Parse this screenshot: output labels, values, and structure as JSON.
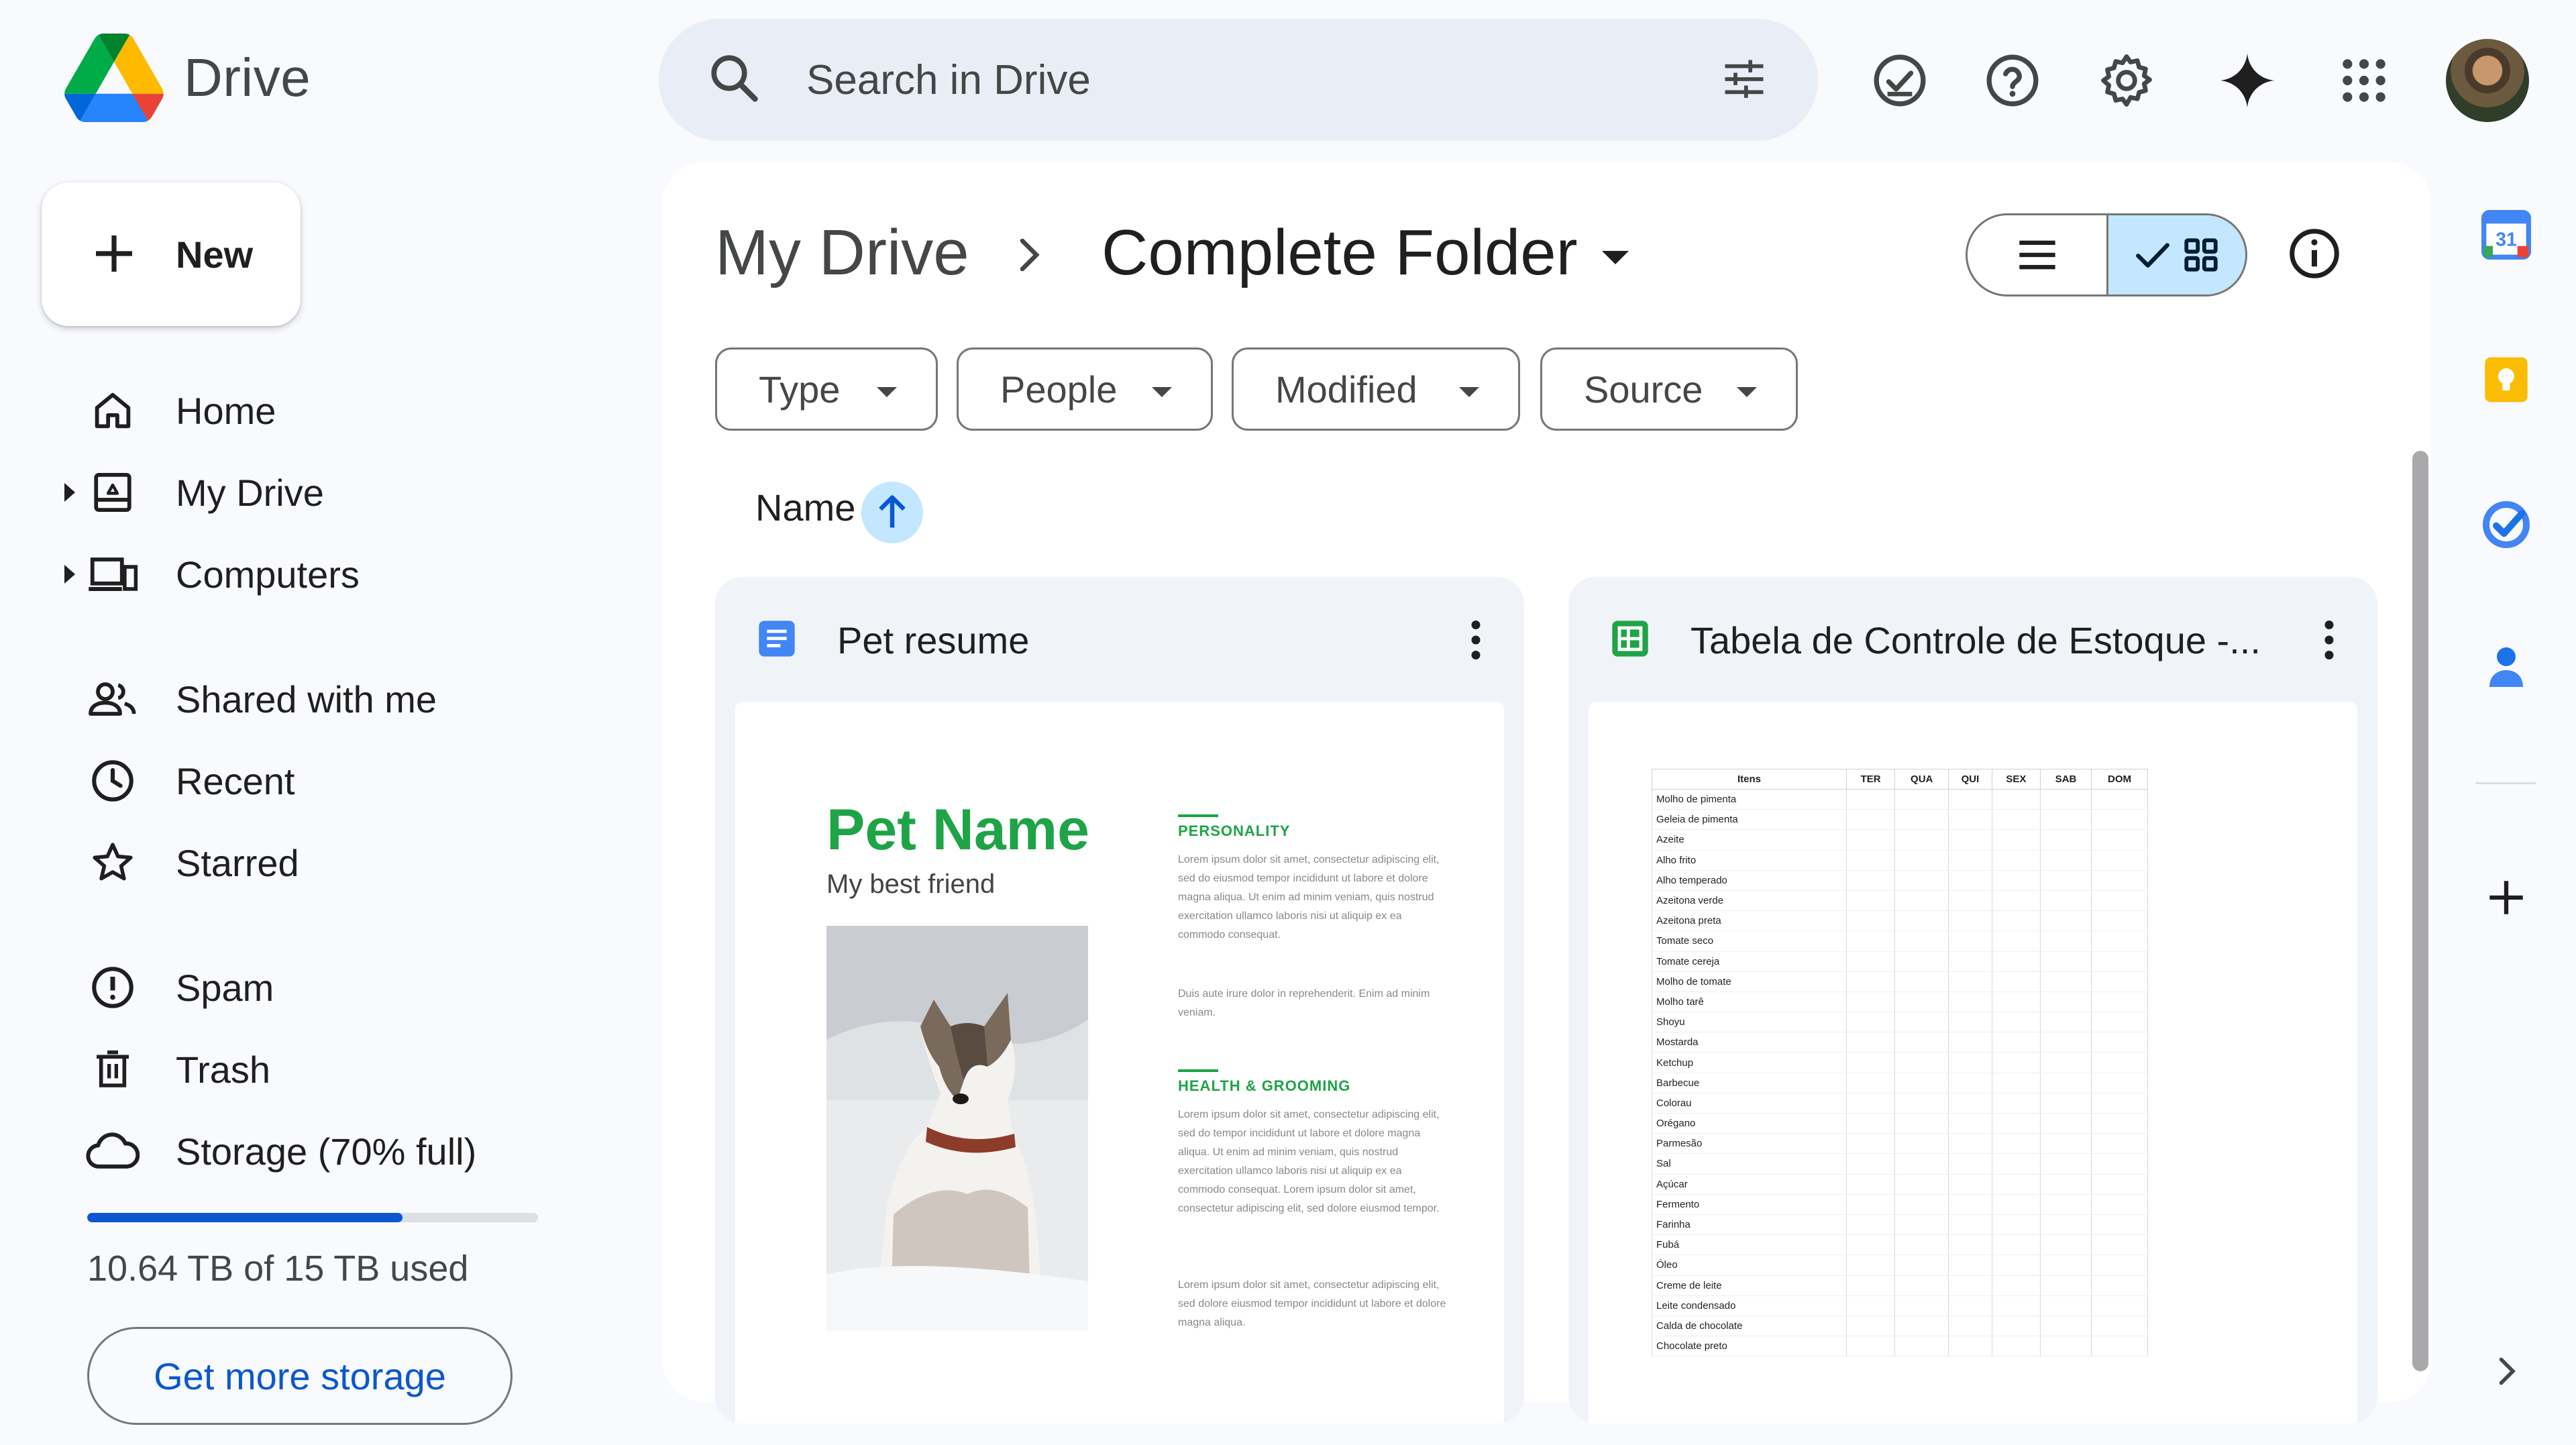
{
  "app": {
    "name": "Drive"
  },
  "search": {
    "placeholder": "Search in Drive"
  },
  "header_icons": [
    "ready-for-offline-icon",
    "help-icon",
    "settings-icon",
    "gemini-sparkle-icon",
    "apps-grid-icon",
    "account-avatar"
  ],
  "sidebar": {
    "new_label": "New",
    "items": [
      {
        "label": "Home",
        "icon": "home-icon"
      },
      {
        "label": "My Drive",
        "icon": "my-drive-icon",
        "expandable": true
      },
      {
        "label": "Computers",
        "icon": "computers-icon",
        "expandable": true
      },
      {
        "label": "Shared with me",
        "icon": "shared-icon"
      },
      {
        "label": "Recent",
        "icon": "clock-icon"
      },
      {
        "label": "Starred",
        "icon": "star-icon"
      },
      {
        "label": "Spam",
        "icon": "spam-icon"
      },
      {
        "label": "Trash",
        "icon": "trash-icon"
      },
      {
        "label": "Storage (70% full)",
        "icon": "cloud-icon"
      }
    ],
    "storage": {
      "fraction_used": 0.7,
      "text": "10.64 TB of 15 TB used",
      "cta": "Get more storage"
    }
  },
  "main": {
    "breadcrumb": {
      "root": "My Drive",
      "current": "Complete Folder"
    },
    "view_mode": "grid",
    "filters": [
      "Type",
      "People",
      "Modified",
      "Source"
    ],
    "sort": {
      "label": "Name",
      "direction": "ascending"
    },
    "files": [
      {
        "title": "Pet resume",
        "kind": "doc",
        "preview": {
          "heading": "Pet Name",
          "subheading": "My best friend",
          "sections": [
            {
              "title": "PERSONALITY",
              "paras": [
                "Lorem ipsum dolor sit amet, consectetur adipiscing elit, sed do eiusmod tempor incididunt ut labore et dolore magna aliqua. Ut enim ad minim veniam, quis nostrud exercitation ullamco laboris nisi ut aliquip ex ea commodo consequat.",
                "Duis aute irure dolor in reprehenderit. Enim ad minim veniam."
              ]
            },
            {
              "title": "HEALTH & GROOMING",
              "paras": [
                "Lorem ipsum dolor sit amet, consectetur adipiscing elit, sed do tempor incididunt ut labore et dolore magna aliqua. Ut enim ad minim veniam, quis nostrud exercitation ullamco laboris nisi ut aliquip ex ea commodo consequat. Lorem ipsum dolor sit amet, consectetur adipiscing elit, sed dolore eiusmod tempor.",
                "Lorem ipsum dolor sit amet, consectetur adipiscing elit, sed dolore eiusmod tempor incididunt ut labore et dolore magna aliqua."
              ]
            }
          ]
        }
      },
      {
        "title": "Tabela de Controle de Estoque -...",
        "kind": "sheet",
        "preview": {
          "columns": [
            "Itens",
            "TER",
            "QUA",
            "QUI",
            "SEX",
            "SAB",
            "DOM"
          ],
          "rows": [
            "Molho de pimenta",
            "Geleia de pimenta",
            "Azeite",
            "Alho frito",
            "Alho temperado",
            "Azeitona verde",
            "Azeitona preta",
            "Tomate seco",
            "Tomate cereja",
            "Molho de tomate",
            "Molho tarê",
            "Shoyu",
            "Mostarda",
            "Ketchup",
            "Barbecue",
            "Colorau",
            "Orégano",
            "Parmesão",
            "Sal",
            "Açúcar",
            "Fermento",
            "Farinha",
            "Fubá",
            "Óleo",
            "Creme de leite",
            "Leite condensado",
            "Calda de chocolate",
            "Chocolate preto"
          ]
        }
      }
    ]
  },
  "right_rail": [
    "calendar-icon",
    "keep-icon",
    "tasks-icon",
    "contacts-icon",
    "add-icon",
    "expand-icon"
  ],
  "colors": {
    "accent": "#0b57d0",
    "selected": "#c2e7ff",
    "doc_blue": "#4285f4",
    "sheet_green": "#1ea446"
  }
}
